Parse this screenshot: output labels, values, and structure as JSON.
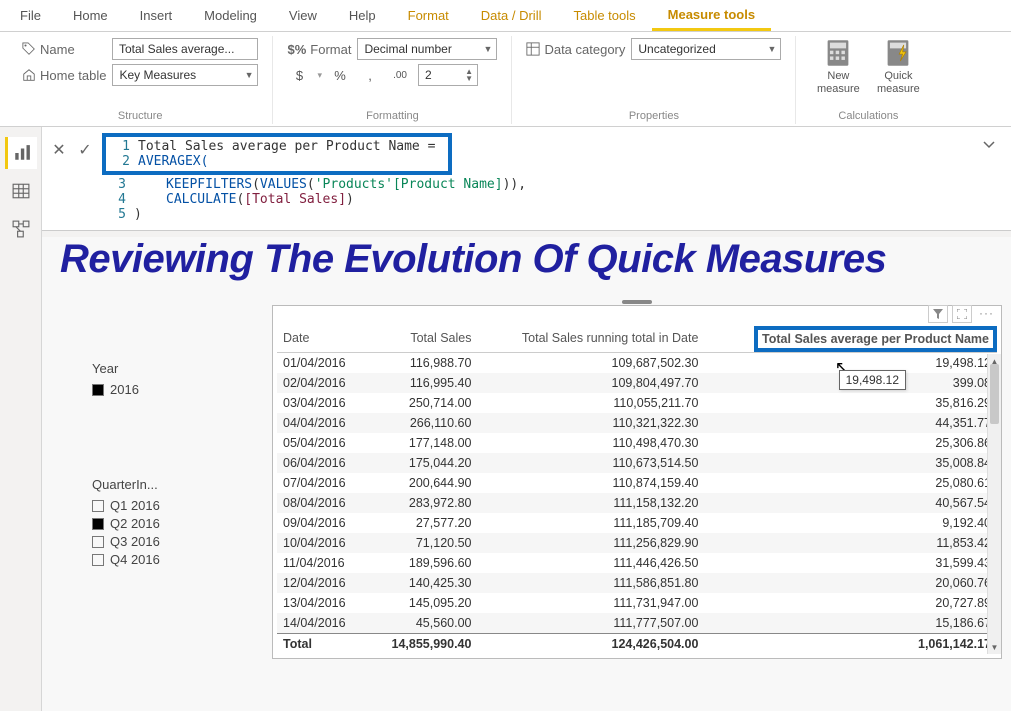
{
  "ribbon": {
    "tabs": {
      "file": "File",
      "home": "Home",
      "insert": "Insert",
      "modeling": "Modeling",
      "view": "View",
      "help": "Help",
      "format": "Format",
      "data_drill": "Data / Drill",
      "table_tools": "Table tools",
      "measure_tools": "Measure tools"
    },
    "name_label": "Name",
    "name_value": "Total Sales average...",
    "home_table_label": "Home table",
    "home_table_value": "Key Measures",
    "structure_caption": "Structure",
    "format_label": "Format",
    "format_value": "Decimal number",
    "currency_btn": "$",
    "percent_btn": "%",
    "comma_btn": ",",
    "decimals_btn": ".00",
    "decimals_value": "2",
    "formatting_caption": "Formatting",
    "data_category_label": "Data category",
    "data_category_value": "Uncategorized",
    "properties_caption": "Properties",
    "new_measure": "New measure",
    "quick_measure": "Quick measure",
    "calculations_caption": "Calculations"
  },
  "formula": {
    "line1_num": "1",
    "line1_text": "Total Sales average per Product Name =",
    "line2_num": "2",
    "line2_text": "AVERAGEX(",
    "line3_num": "3",
    "line3_kw1": "KEEPFILTERS",
    "line3_paren1": "(",
    "line3_kw2": "VALUES",
    "line3_paren2": "(",
    "line3_ref": "'Products'[Product Name]",
    "line3_end": ")),",
    "line4_num": "4",
    "line4_kw": "CALCULATE",
    "line4_paren": "(",
    "line4_measure": "[Total Sales]",
    "line4_end": ")",
    "line5_num": "5",
    "line5_text": ")"
  },
  "background_title": "Reviewing The Evolution Of Quick Measures",
  "slicers": {
    "year": {
      "title": "Year",
      "items": [
        "2016"
      ],
      "checked": [
        true
      ]
    },
    "quarter": {
      "title": "QuarterIn...",
      "items": [
        "Q1 2016",
        "Q2 2016",
        "Q3 2016",
        "Q4 2016"
      ],
      "checked": [
        false,
        true,
        false,
        false
      ]
    }
  },
  "table": {
    "headers": {
      "date": "Date",
      "total_sales": "Total Sales",
      "running": "Total Sales running total in Date",
      "avg_per_product": "Total Sales average per Product Name"
    },
    "rows": [
      {
        "date": "01/04/2016",
        "sales": "116,988.70",
        "running": "109,687,502.30",
        "avg": "19,498.12"
      },
      {
        "date": "02/04/2016",
        "sales": "116,995.40",
        "running": "109,804,497.70",
        "avg": "399.08"
      },
      {
        "date": "03/04/2016",
        "sales": "250,714.00",
        "running": "110,055,211.70",
        "avg": "35,816.29"
      },
      {
        "date": "04/04/2016",
        "sales": "266,110.60",
        "running": "110,321,322.30",
        "avg": "44,351.77"
      },
      {
        "date": "05/04/2016",
        "sales": "177,148.00",
        "running": "110,498,470.30",
        "avg": "25,306.86"
      },
      {
        "date": "06/04/2016",
        "sales": "175,044.20",
        "running": "110,673,514.50",
        "avg": "35,008.84"
      },
      {
        "date": "07/04/2016",
        "sales": "200,644.90",
        "running": "110,874,159.40",
        "avg": "25,080.61"
      },
      {
        "date": "08/04/2016",
        "sales": "283,972.80",
        "running": "111,158,132.20",
        "avg": "40,567.54"
      },
      {
        "date": "09/04/2016",
        "sales": "27,577.20",
        "running": "111,185,709.40",
        "avg": "9,192.40"
      },
      {
        "date": "10/04/2016",
        "sales": "71,120.50",
        "running": "111,256,829.90",
        "avg": "11,853.42"
      },
      {
        "date": "11/04/2016",
        "sales": "189,596.60",
        "running": "111,446,426.50",
        "avg": "31,599.43"
      },
      {
        "date": "12/04/2016",
        "sales": "140,425.30",
        "running": "111,586,851.80",
        "avg": "20,060.76"
      },
      {
        "date": "13/04/2016",
        "sales": "145,095.20",
        "running": "111,731,947.00",
        "avg": "20,727.89"
      },
      {
        "date": "14/04/2016",
        "sales": "45,560.00",
        "running": "111,777,507.00",
        "avg": "15,186.67"
      }
    ],
    "total": {
      "label": "Total",
      "sales": "14,855,990.40",
      "running": "124,426,504.00",
      "avg": "1,061,142.17"
    }
  },
  "tooltip_value": "19,498.12"
}
